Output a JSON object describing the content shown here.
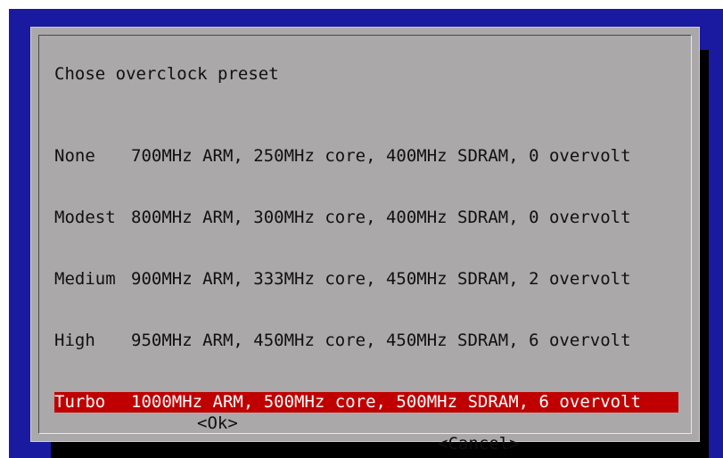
{
  "dialog": {
    "title": "Chose overclock preset",
    "items": [
      {
        "tag": "None",
        "desc": "700MHz ARM, 250MHz core, 400MHz SDRAM, 0 overvolt",
        "selected": false
      },
      {
        "tag": "Modest",
        "desc": "800MHz ARM, 300MHz core, 400MHz SDRAM, 0 overvolt",
        "selected": false
      },
      {
        "tag": "Medium",
        "desc": "900MHz ARM, 333MHz core, 450MHz SDRAM, 2 overvolt",
        "selected": false
      },
      {
        "tag": "High",
        "desc": "950MHz ARM, 450MHz core, 450MHz SDRAM, 6 overvolt",
        "selected": false
      },
      {
        "tag": "Turbo",
        "desc": "1000MHz ARM, 500MHz core, 500MHz SDRAM, 6 overvolt",
        "selected": true
      }
    ],
    "ok_label": "<Ok>",
    "cancel_label": "<Cancel>"
  },
  "colors": {
    "background": "#1a1aa0",
    "dialog": "#aaa8a8",
    "selection": "#c00000"
  }
}
